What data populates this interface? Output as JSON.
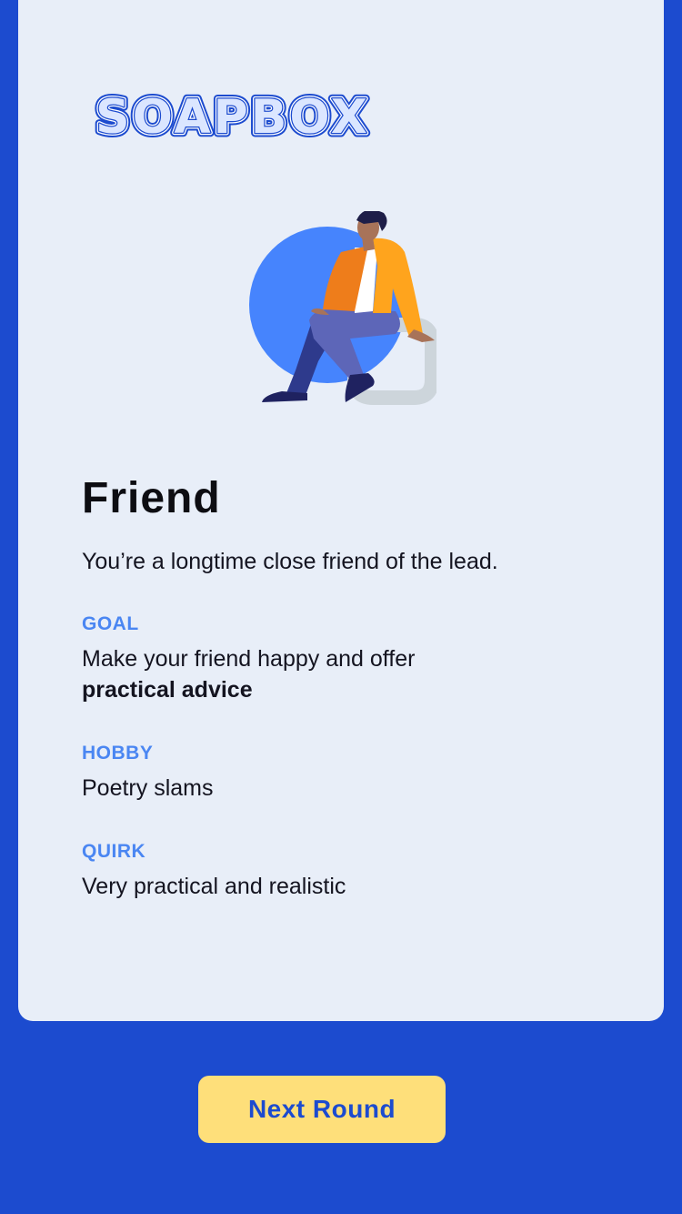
{
  "brand": {
    "logo_text": "SOAPBOX"
  },
  "role": {
    "title": "Friend",
    "description": "You’re a longtime close friend of the lead."
  },
  "sections": {
    "goal": {
      "label": "GOAL",
      "text": "Make your friend happy and offer",
      "emphasis": "practical advice"
    },
    "hobby": {
      "label": "HOBBY",
      "text": "Poetry slams"
    },
    "quirk": {
      "label": "QUIRK",
      "text": "Very practical and realistic"
    }
  },
  "actions": {
    "next_label": "Next Round"
  },
  "colors": {
    "background": "#1c4bcf",
    "card": "#e8eef8",
    "accent_label": "#4a86f2",
    "button": "#fedf7a"
  },
  "icons": {
    "illustration": "person-sitting-illustration"
  }
}
